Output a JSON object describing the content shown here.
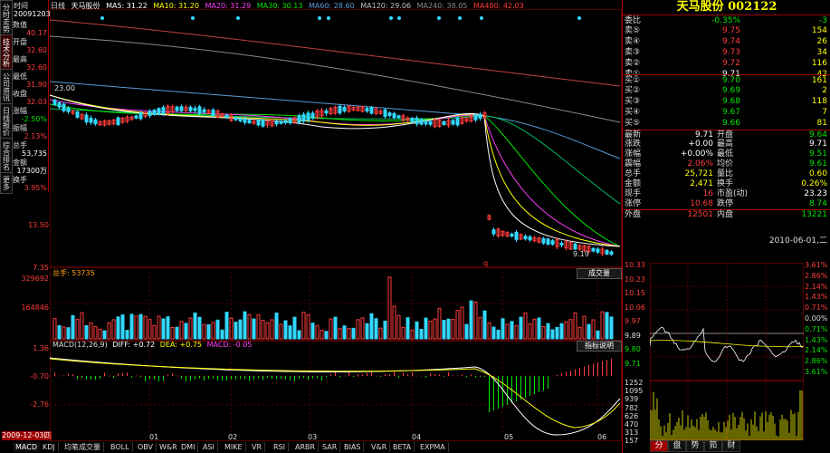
{
  "header": {
    "period": "日线",
    "name": "天马股份",
    "ma5": "MA5: 31.22",
    "ma10": "MA10: 31.20",
    "ma20": "MA20: 31.29",
    "ma30": "MA30: 30.13",
    "ma60": "MA60: 28.60",
    "ma120": "MA120: 29.06",
    "ma240": "MA240: 38.05",
    "ma480": "MA480: 42.03",
    "colors": {
      "bg": "#000000",
      "up": "#ff3c3c",
      "down": "#32d8ff",
      "grid": "#a00000"
    }
  },
  "left_tabs": [
    "分时走势",
    "技术分析",
    "公司资讯",
    "日线报价",
    "综合排名",
    "更多"
  ],
  "info_panel": {
    "time_label": "时间",
    "time_value": "20091203",
    "rows": [
      {
        "label": "数值",
        "value": "40.17"
      },
      {
        "label": "开盘",
        "value": "32.60"
      },
      {
        "label": "最高",
        "value": "32.60"
      },
      {
        "label": "最低",
        "value": "31.90"
      },
      {
        "label": "收盘",
        "value": "32.03"
      },
      {
        "label": "涨幅",
        "value": "-2.50%"
      },
      {
        "label": "振幅",
        "value": "2.13%"
      },
      {
        "label": "总手",
        "value": "53,735"
      },
      {
        "label": "金额",
        "value": "17300万"
      },
      {
        "label": "换手",
        "value": "3.95%"
      }
    ],
    "price_axis": [
      "13.50",
      "7.35"
    ],
    "vol_axis": [
      "329692",
      "164846"
    ],
    "macd_axis": [
      "1.36",
      "-0.70",
      "-2.76"
    ],
    "date_box": "2009-12-03四"
  },
  "kline": {
    "high_marker": "23.00",
    "low_marker": "9.19",
    "q_marker": "q"
  },
  "volume": {
    "label": "总手: 53735",
    "button": "成交量"
  },
  "macd": {
    "label": "MACD(12,26,9)",
    "diff": "DIFF: +0.72",
    "dea": "DEA: +0.75",
    "macd": "MACD: -0.05",
    "button": "指标说明"
  },
  "x_axis": [
    "01",
    "02",
    "03",
    "04",
    "05",
    "06"
  ],
  "bottom_tabs": [
    "MACD",
    "KDJ",
    "均笔成交量",
    "BOLL",
    "OBV",
    "W&R",
    "DMI",
    "ASI",
    "MIKE",
    "VR",
    "RSI",
    "ARBR",
    "SAR",
    "BIAS",
    "V&R",
    "BETA",
    "EXPMA"
  ],
  "quote": {
    "title": "天马股份 002122",
    "weibi": {
      "label": "委比",
      "value": "-0.35%",
      "diff": "-3"
    },
    "sells": [
      {
        "label": "卖⑤",
        "price": "9.75",
        "vol": "154"
      },
      {
        "label": "卖④",
        "price": "9.74",
        "vol": "26"
      },
      {
        "label": "卖③",
        "price": "9.73",
        "vol": "34"
      },
      {
        "label": "卖②",
        "price": "9.72",
        "vol": "116"
      },
      {
        "label": "卖①",
        "price": "9.71",
        "vol": "42"
      }
    ],
    "buys": [
      {
        "label": "买①",
        "price": "9.70",
        "vol": "161"
      },
      {
        "label": "买②",
        "price": "9.69",
        "vol": "2"
      },
      {
        "label": "买③",
        "price": "9.68",
        "vol": "118"
      },
      {
        "label": "买④",
        "price": "9.67",
        "vol": "7"
      },
      {
        "label": "买⑤",
        "price": "9.66",
        "vol": "81"
      }
    ],
    "stats": [
      {
        "l1": "最新",
        "v1": "9.71",
        "l2": "开盘",
        "v2": "9.64"
      },
      {
        "l1": "涨跌",
        "v1": "+0.00",
        "l2": "最高",
        "v2": "9.71"
      },
      {
        "l1": "涨幅",
        "v1": "+0.00%",
        "l2": "最低",
        "v2": "9.51"
      },
      {
        "l1": "震幅",
        "v1": "2.06%",
        "l2": "均价",
        "v2": "9.61"
      },
      {
        "l1": "总手",
        "v1": "25,721",
        "l2": "量比",
        "v2": "0.60"
      },
      {
        "l1": "金额",
        "v1": "2,471",
        "l2": "换手",
        "v2": "0.26%"
      },
      {
        "l1": "现手",
        "v1": "16",
        "l2": "市盈(动)",
        "v2": "23.23"
      },
      {
        "l1": "涨停",
        "v1": "10.68",
        "l2": "跌停",
        "v2": "8.74"
      },
      {
        "l1": "外盘",
        "v1": "12501",
        "l2": "内盘",
        "v2": "13221"
      }
    ],
    "date_line": "2010-06-01,二"
  },
  "mini": {
    "price_left": [
      "10.33",
      "10.23",
      "10.15",
      "10.06",
      "9.97",
      "9.89",
      "9.80",
      "9.71"
    ],
    "price_right": [
      "3.61%",
      "2.86%",
      "2.14%",
      "1.43%",
      "0.71%",
      "0.00%",
      "0.71%",
      "1.43%",
      "2.14%",
      "2.86%",
      "3.61%"
    ],
    "vol_left": [
      "1252",
      "1095",
      "939",
      "782",
      "626",
      "470",
      "313",
      "157"
    ],
    "tabs": [
      "分",
      "盘",
      "势",
      "筘",
      "财"
    ]
  }
}
